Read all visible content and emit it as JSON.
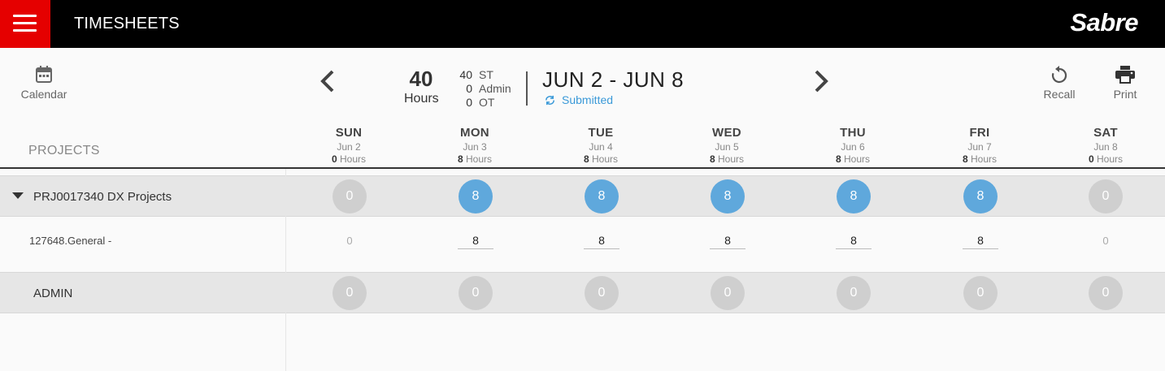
{
  "app": {
    "title": "TIMESHEETS",
    "brand": "Sabre"
  },
  "toolbar": {
    "calendar_label": "Calendar",
    "recall_label": "Recall",
    "print_label": "Print"
  },
  "summary": {
    "total_hours": "40",
    "total_label": "Hours",
    "breakdown": [
      {
        "value": "40",
        "label": "ST"
      },
      {
        "value": "0",
        "label": "Admin"
      },
      {
        "value": "0",
        "label": "OT"
      }
    ],
    "week_range": "JUN 2 - JUN 8",
    "status": "Submitted"
  },
  "table": {
    "projects_header": "PROJECTS",
    "days": [
      {
        "name": "SUN",
        "date": "Jun 2",
        "hours": "0",
        "hours_unit": " Hours"
      },
      {
        "name": "MON",
        "date": "Jun 3",
        "hours": "8",
        "hours_unit": " Hours"
      },
      {
        "name": "TUE",
        "date": "Jun 4",
        "hours": "8",
        "hours_unit": " Hours"
      },
      {
        "name": "WED",
        "date": "Jun 5",
        "hours": "8",
        "hours_unit": " Hours"
      },
      {
        "name": "THU",
        "date": "Jun 6",
        "hours": "8",
        "hours_unit": " Hours"
      },
      {
        "name": "FRI",
        "date": "Jun 7",
        "hours": "8",
        "hours_unit": " Hours"
      },
      {
        "name": "SAT",
        "date": "Jun 8",
        "hours": "0",
        "hours_unit": " Hours"
      }
    ],
    "project_row": {
      "label": "PRJ0017340 DX Projects",
      "values": [
        "0",
        "8",
        "8",
        "8",
        "8",
        "8",
        "0"
      ]
    },
    "task_row": {
      "label": "127648.General -",
      "values": [
        "0",
        "8",
        "8",
        "8",
        "8",
        "8",
        "0"
      ]
    },
    "admin_row": {
      "label": "ADMIN",
      "values": [
        "0",
        "0",
        "0",
        "0",
        "0",
        "0",
        "0"
      ]
    }
  },
  "colors": {
    "menu_red": "#e50000",
    "active_circle": "#5fa8dc",
    "zero_circle": "#cfcfcf",
    "status_blue": "#3a99d8"
  }
}
